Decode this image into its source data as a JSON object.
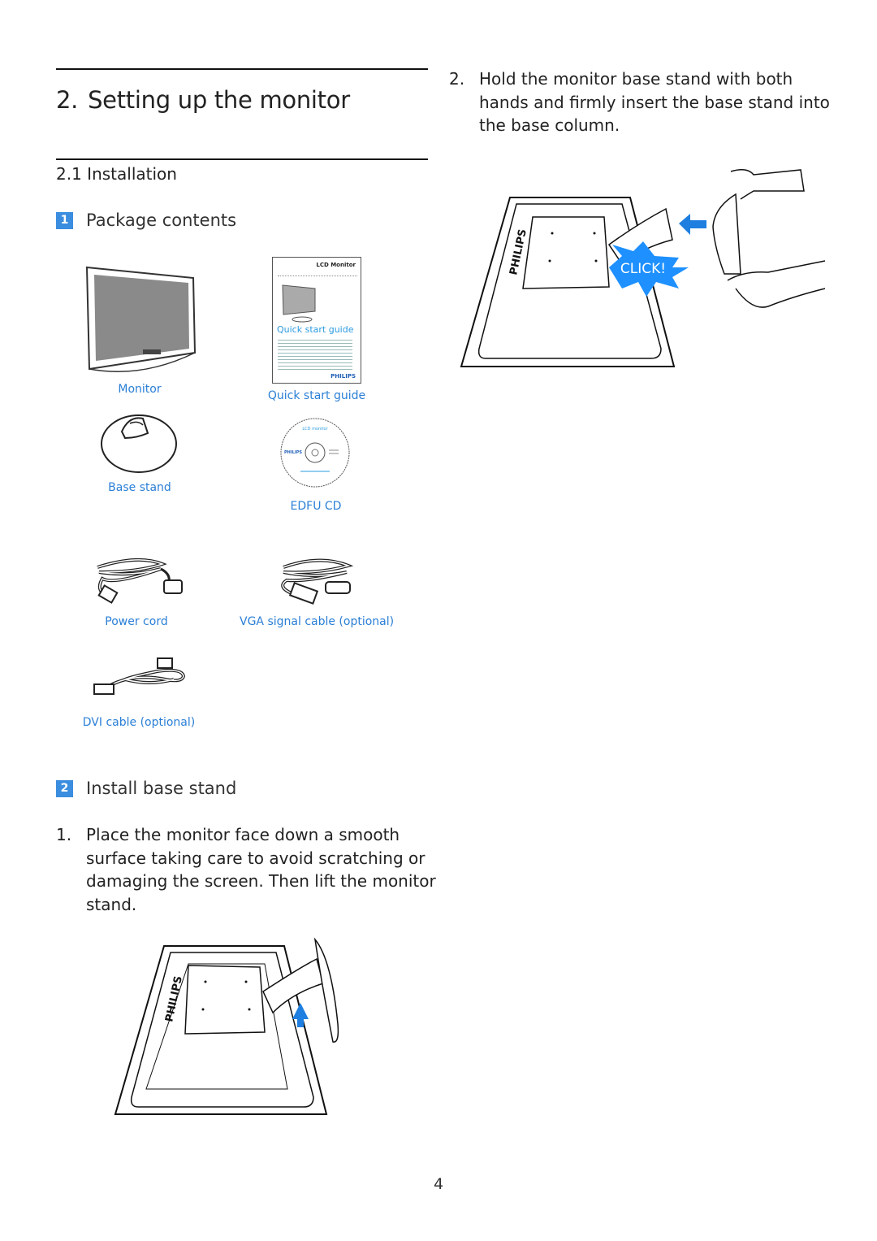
{
  "chapter": {
    "number": "2.",
    "title": "Setting up the monitor"
  },
  "section": {
    "number": "2.1",
    "title": "Installation"
  },
  "package": {
    "badge": "1",
    "title": "Package contents",
    "items": [
      {
        "label": "Monitor",
        "icon": "monitor-icon"
      },
      {
        "label": "Quick start guide",
        "icon": "quick-start-guide-icon"
      },
      {
        "label": "Base stand",
        "icon": "base-stand-icon"
      },
      {
        "label": "EDFU CD",
        "icon": "cd-icon"
      },
      {
        "label": "Power cord",
        "icon": "power-cord-icon"
      },
      {
        "label": "VGA signal cable (optional)",
        "icon": "vga-cable-icon"
      },
      {
        "label": "DVI cable (optional)",
        "icon": "dvi-cable-icon"
      }
    ],
    "guide_cover": {
      "heading": "LCD Monitor",
      "title": "Quick start guide",
      "brand": "PHILIPS"
    },
    "cd_label": {
      "heading": "LCD monitor",
      "brand": "PHILIPS"
    }
  },
  "install": {
    "badge": "2",
    "title": "Install base stand",
    "steps": [
      {
        "n": "1.",
        "text": "Place the monitor face down a smooth surface taking care to avoid scratching or damaging the screen. Then lift the monitor stand."
      },
      {
        "n": "2.",
        "text": "Hold the monitor base stand with both hands and firmly insert the base stand into the base column."
      }
    ],
    "click_label": "CLICK!",
    "monitor_brand": "PHILIPS"
  },
  "colors": {
    "accent": "#3b8ddf",
    "caption": "#2a7fd6",
    "click": "#1e90ff"
  },
  "page_number": "4"
}
